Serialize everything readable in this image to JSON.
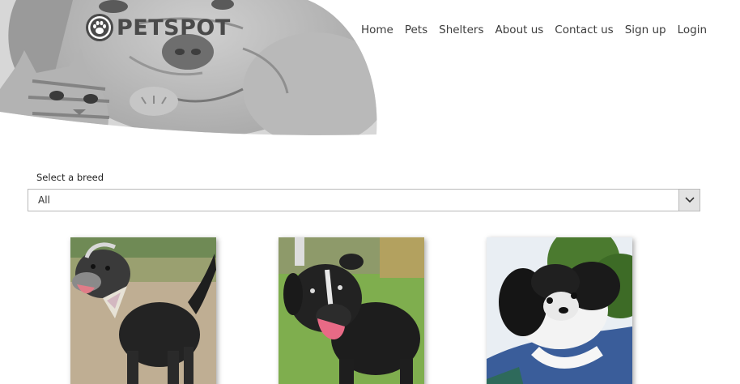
{
  "header": {
    "logo_text": "PETSPOT",
    "logo_icon": "paw-icon",
    "nav": [
      "Home",
      "Pets",
      "Shelters",
      "About us",
      "Contact us",
      "Sign up",
      "Login"
    ]
  },
  "filter": {
    "label": "Select a breed",
    "selected": "All",
    "arrow_icon": "chevron-down-icon"
  },
  "pets": [
    {
      "photo": "scruffy black and grey dog wearing a bandana"
    },
    {
      "photo": "black labrador mix with tongue out on grass"
    },
    {
      "photo": "black and white shih tzu lying on blue fabric"
    }
  ],
  "colors": {
    "logo": "#4a4a4a",
    "nav_text": "#3c3c3c",
    "select_border": "#b9b9b9",
    "select_arrow_bg": "#e3e3e3"
  }
}
